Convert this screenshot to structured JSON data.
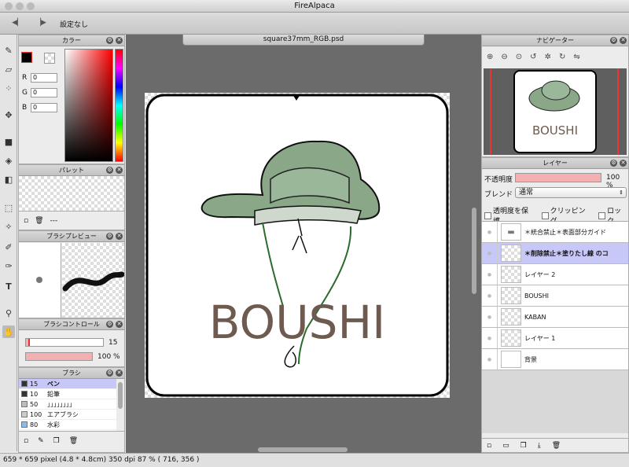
{
  "window": {
    "title": "FireAlpaca"
  },
  "toolbar": {
    "back_icon": "back-arrow-icon",
    "forward_icon": "forward-arrow-icon",
    "preset_label": "設定なし"
  },
  "color_panel": {
    "title": "カラー",
    "r_label": "R",
    "g_label": "G",
    "b_label": "B",
    "r": "0",
    "g": "0",
    "b": "0"
  },
  "palette_panel": {
    "title": "パレット",
    "footer_text": "---"
  },
  "brush_preview": {
    "title": "ブラシプレビュー"
  },
  "brush_control": {
    "title": "ブラシコントロール",
    "size_value": "15",
    "opacity_value": "100 %",
    "size_fraction": 0.05
  },
  "brush_panel": {
    "title": "ブラシ",
    "items": [
      {
        "size": "15",
        "name": "ペン",
        "selected": true,
        "swatch": "#333333"
      },
      {
        "size": "10",
        "name": "鉛筆",
        "selected": false,
        "swatch": "#333333"
      },
      {
        "size": "50",
        "name": "」」」」」」」」",
        "selected": false,
        "swatch": "#bbbbbb"
      },
      {
        "size": "100",
        "name": "エアブラシ",
        "selected": false,
        "swatch": "#cccccc"
      },
      {
        "size": "80",
        "name": "水彩",
        "selected": false,
        "swatch": "#88bbee"
      }
    ]
  },
  "canvas": {
    "tab_label": "square37mm_RGB.psd",
    "artwork_text": "BOUSHI"
  },
  "navigator": {
    "title": "ナビゲーター",
    "preview_text": "BOUSHI"
  },
  "layer_panel": {
    "title": "レイヤー",
    "opacity_label": "不透明度",
    "opacity_value": "100 %",
    "blend_label": "ブレンド",
    "blend_value": "通常",
    "protect_label": "透明度を保護",
    "clipping_label": "クリッピング",
    "lock_label": "ロック",
    "layers": [
      {
        "name": "＊統合禁止＊表面部分ガイド",
        "type": "folder",
        "selected": false
      },
      {
        "name": "＊削除禁止＊塗りたし線 のコ",
        "type": "layer",
        "selected": true
      },
      {
        "name": "レイヤー 2",
        "type": "layer",
        "selected": false
      },
      {
        "name": "BOUSHI",
        "type": "layer",
        "selected": false
      },
      {
        "name": "KABAN",
        "type": "layer",
        "selected": false
      },
      {
        "name": "レイヤー 1",
        "type": "layer",
        "selected": false
      },
      {
        "name": "背景",
        "type": "background",
        "selected": false
      }
    ]
  },
  "status": {
    "text": "659 * 659 pixel  (4.8 * 4.8cm)  350 dpi  87 %  ( 716, 356 )"
  },
  "colors": {
    "accent": "#c8c8f8",
    "opacity_bar": "#f4b0b0",
    "hat_green": "#8aa888",
    "boushi_text": "#6e5a4e"
  }
}
